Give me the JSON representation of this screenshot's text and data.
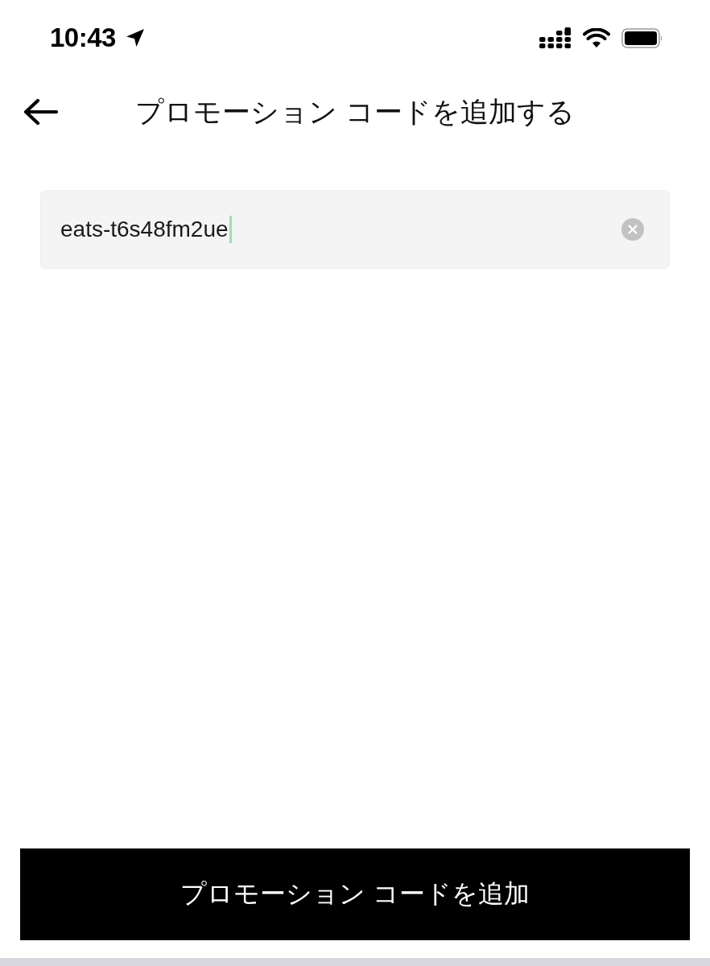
{
  "status_bar": {
    "time": "10:43",
    "location_active": true
  },
  "header": {
    "title": "プロモーション コードを追加する"
  },
  "promo_field": {
    "value": "eats-t6s48fm2ue",
    "focused": true
  },
  "submit_button": {
    "label": "プロモーション コードを追加"
  }
}
